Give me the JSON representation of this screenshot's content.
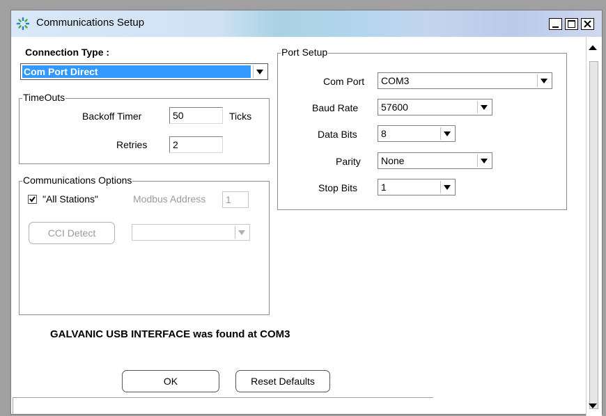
{
  "window": {
    "title": "Communications Setup",
    "minimize_label": "_",
    "maximize_label": "□",
    "close_label": "X"
  },
  "connection": {
    "label": "Connection Type :",
    "selected": "Com Port Direct"
  },
  "timeouts": {
    "group_label": "TimeOuts",
    "backoff_label": "Backoff Timer",
    "backoff_value": "50",
    "backoff_unit": "Ticks",
    "retries_label": "Retries",
    "retries_value": "2"
  },
  "comm_options": {
    "group_label": "Communications Options",
    "all_stations_label": "\"All Stations\"",
    "all_stations_checked": true,
    "modbus_label": "Modbus Address",
    "modbus_value": "1",
    "cci_detect_label": "CCI Detect",
    "cci_select_value": ""
  },
  "port_setup": {
    "group_label": "Port Setup",
    "com_port_label": "Com Port",
    "com_port_value": "COM3",
    "baud_rate_label": "Baud Rate",
    "baud_rate_value": "57600",
    "data_bits_label": "Data Bits",
    "data_bits_value": "8",
    "parity_label": "Parity",
    "parity_value": "None",
    "stop_bits_label": "Stop Bits",
    "stop_bits_value": "1"
  },
  "status": {
    "message": "GALVANIC USB INTERFACE was found at COM3"
  },
  "buttons": {
    "ok_label": "OK",
    "reset_label": "Reset Defaults"
  }
}
